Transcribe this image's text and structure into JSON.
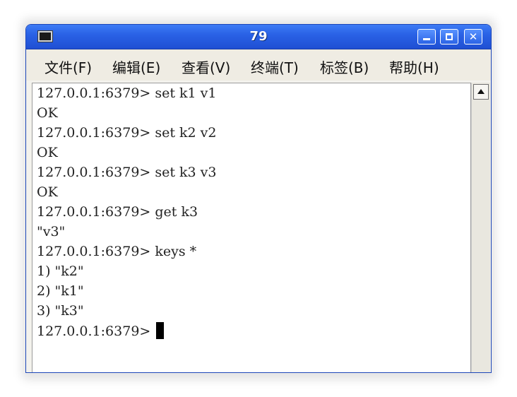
{
  "window": {
    "title": "79"
  },
  "menu": {
    "items": [
      {
        "label": "文件(F)"
      },
      {
        "label": "编辑(E)"
      },
      {
        "label": "查看(V)"
      },
      {
        "label": "终端(T)"
      },
      {
        "label": "标签(B)"
      },
      {
        "label": "帮助(H)"
      }
    ]
  },
  "terminal": {
    "lines": [
      "127.0.0.1:6379> set k1 v1",
      "OK",
      "127.0.0.1:6379> set k2 v2",
      "OK",
      "127.0.0.1:6379> set k3 v3",
      "OK",
      "127.0.0.1:6379> get k3",
      "\"v3\"",
      "127.0.0.1:6379> keys *",
      "1) \"k2\"",
      "2) \"k1\"",
      "3) \"k3\"",
      "127.0.0.1:6379> "
    ]
  },
  "icons": {
    "app": "terminal-icon",
    "minimize": "minimize-icon",
    "maximize": "maximize-icon",
    "close": "close-icon",
    "scroll_up": "arrow-up-icon"
  },
  "colors": {
    "titlebar": "#2a62e6",
    "menubar": "#efece3",
    "terminal_bg": "#ffffff",
    "terminal_text": "#222222"
  }
}
